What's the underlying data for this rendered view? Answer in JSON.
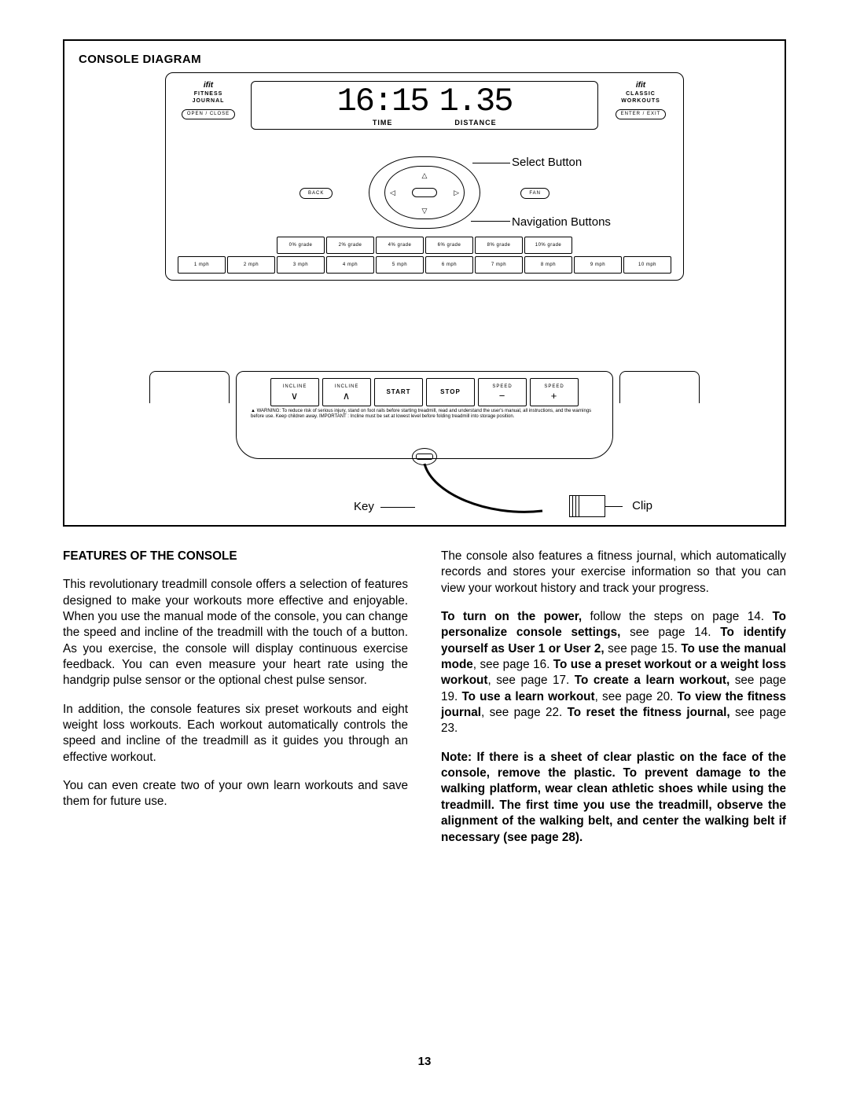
{
  "diagram_title": "CONSOLE DIAGRAM",
  "fitness_pod": {
    "brand": "ifit",
    "l1": "FITNESS",
    "l2": "JOURNAL",
    "btn": "OPEN / CLOSE"
  },
  "classic_pod": {
    "brand": "ifit",
    "l1": "CLASSIC",
    "l2": "WORKOUTS",
    "btn": "ENTER / EXIT"
  },
  "lcd": {
    "time_val": "16:15",
    "time_lbl": "TIME",
    "dist_val": "1.35",
    "dist_lbl": "DISTANCE"
  },
  "nav": {
    "back": "BACK",
    "fan": "FAN",
    "select_label": "Select Button",
    "nav_label": "Navigation Buttons"
  },
  "grades": [
    "0% grade",
    "2% grade",
    "4% grade",
    "6% grade",
    "8% grade",
    "10% grade"
  ],
  "speeds": [
    "1 mph",
    "2 mph",
    "3 mph",
    "4 mph",
    "5 mph",
    "6 mph",
    "7 mph",
    "8 mph",
    "9 mph",
    "10 mph"
  ],
  "ctrls": {
    "incline_label": "INCLINE",
    "speed_label": "SPEED",
    "start": "START",
    "stop": "STOP"
  },
  "warning": "WARNING: To reduce risk of serious injury, stand on foot rails before starting treadmill, read and understand the user's manual, all instructions, and the warnings before use. Keep children away.   IMPORTANT : Incline must be set at lowest level before folding treadmill into storage position.",
  "key_label": "Key",
  "clip_label": "Clip",
  "section_heading": "FEATURES OF THE CONSOLE",
  "para1": "This revolutionary treadmill console offers a selection of features designed to make your workouts more effective and enjoyable. When you use the manual mode of the console, you can change the speed and incline of the treadmill with the touch of a button. As you exercise, the console will display continuous exercise feedback. You can even measure your heart rate using the handgrip pulse sensor or the optional chest pulse sensor.",
  "para2": "In addition, the console features six preset workouts and eight weight loss workouts. Each workout automatically controls the speed and incline of the treadmill as it guides you through an effective workout.",
  "para3": "You can even create two of your own learn workouts and save them for future use.",
  "para4": "The console also features a fitness journal, which automatically records and stores your exercise information so that you can view your workout history and track your progress.",
  "instr": {
    "t1": "To turn on the power,",
    "s1": " follow the steps on page 14. ",
    "t2": "To personalize console settings,",
    "s2": " see page 14. ",
    "t3": "To identify yourself as User 1 or User 2,",
    "s3": " see page 15. ",
    "t4": "To use the manual mode",
    "s4": ", see page 16. ",
    "t5": "To use a preset workout or a weight loss workout",
    "s5": ", see page 17. ",
    "t6": "To create a learn workout,",
    "s6": " see page 19. ",
    "t7": "To use a learn workout",
    "s7": ", see page 20. ",
    "t8": "To view the fitness journal",
    "s8": ", see page 22. ",
    "t9": "To reset the fitness journal,",
    "s9": " see page 23."
  },
  "note": "Note: If there is a sheet of clear plastic on the face of the console, remove the plastic. To prevent damage to the walking platform, wear clean athletic shoes while using the treadmill. The first time you use the treadmill, observe the alignment of the walking belt, and center the walking belt if necessary (see page 28).",
  "page_no": "13"
}
